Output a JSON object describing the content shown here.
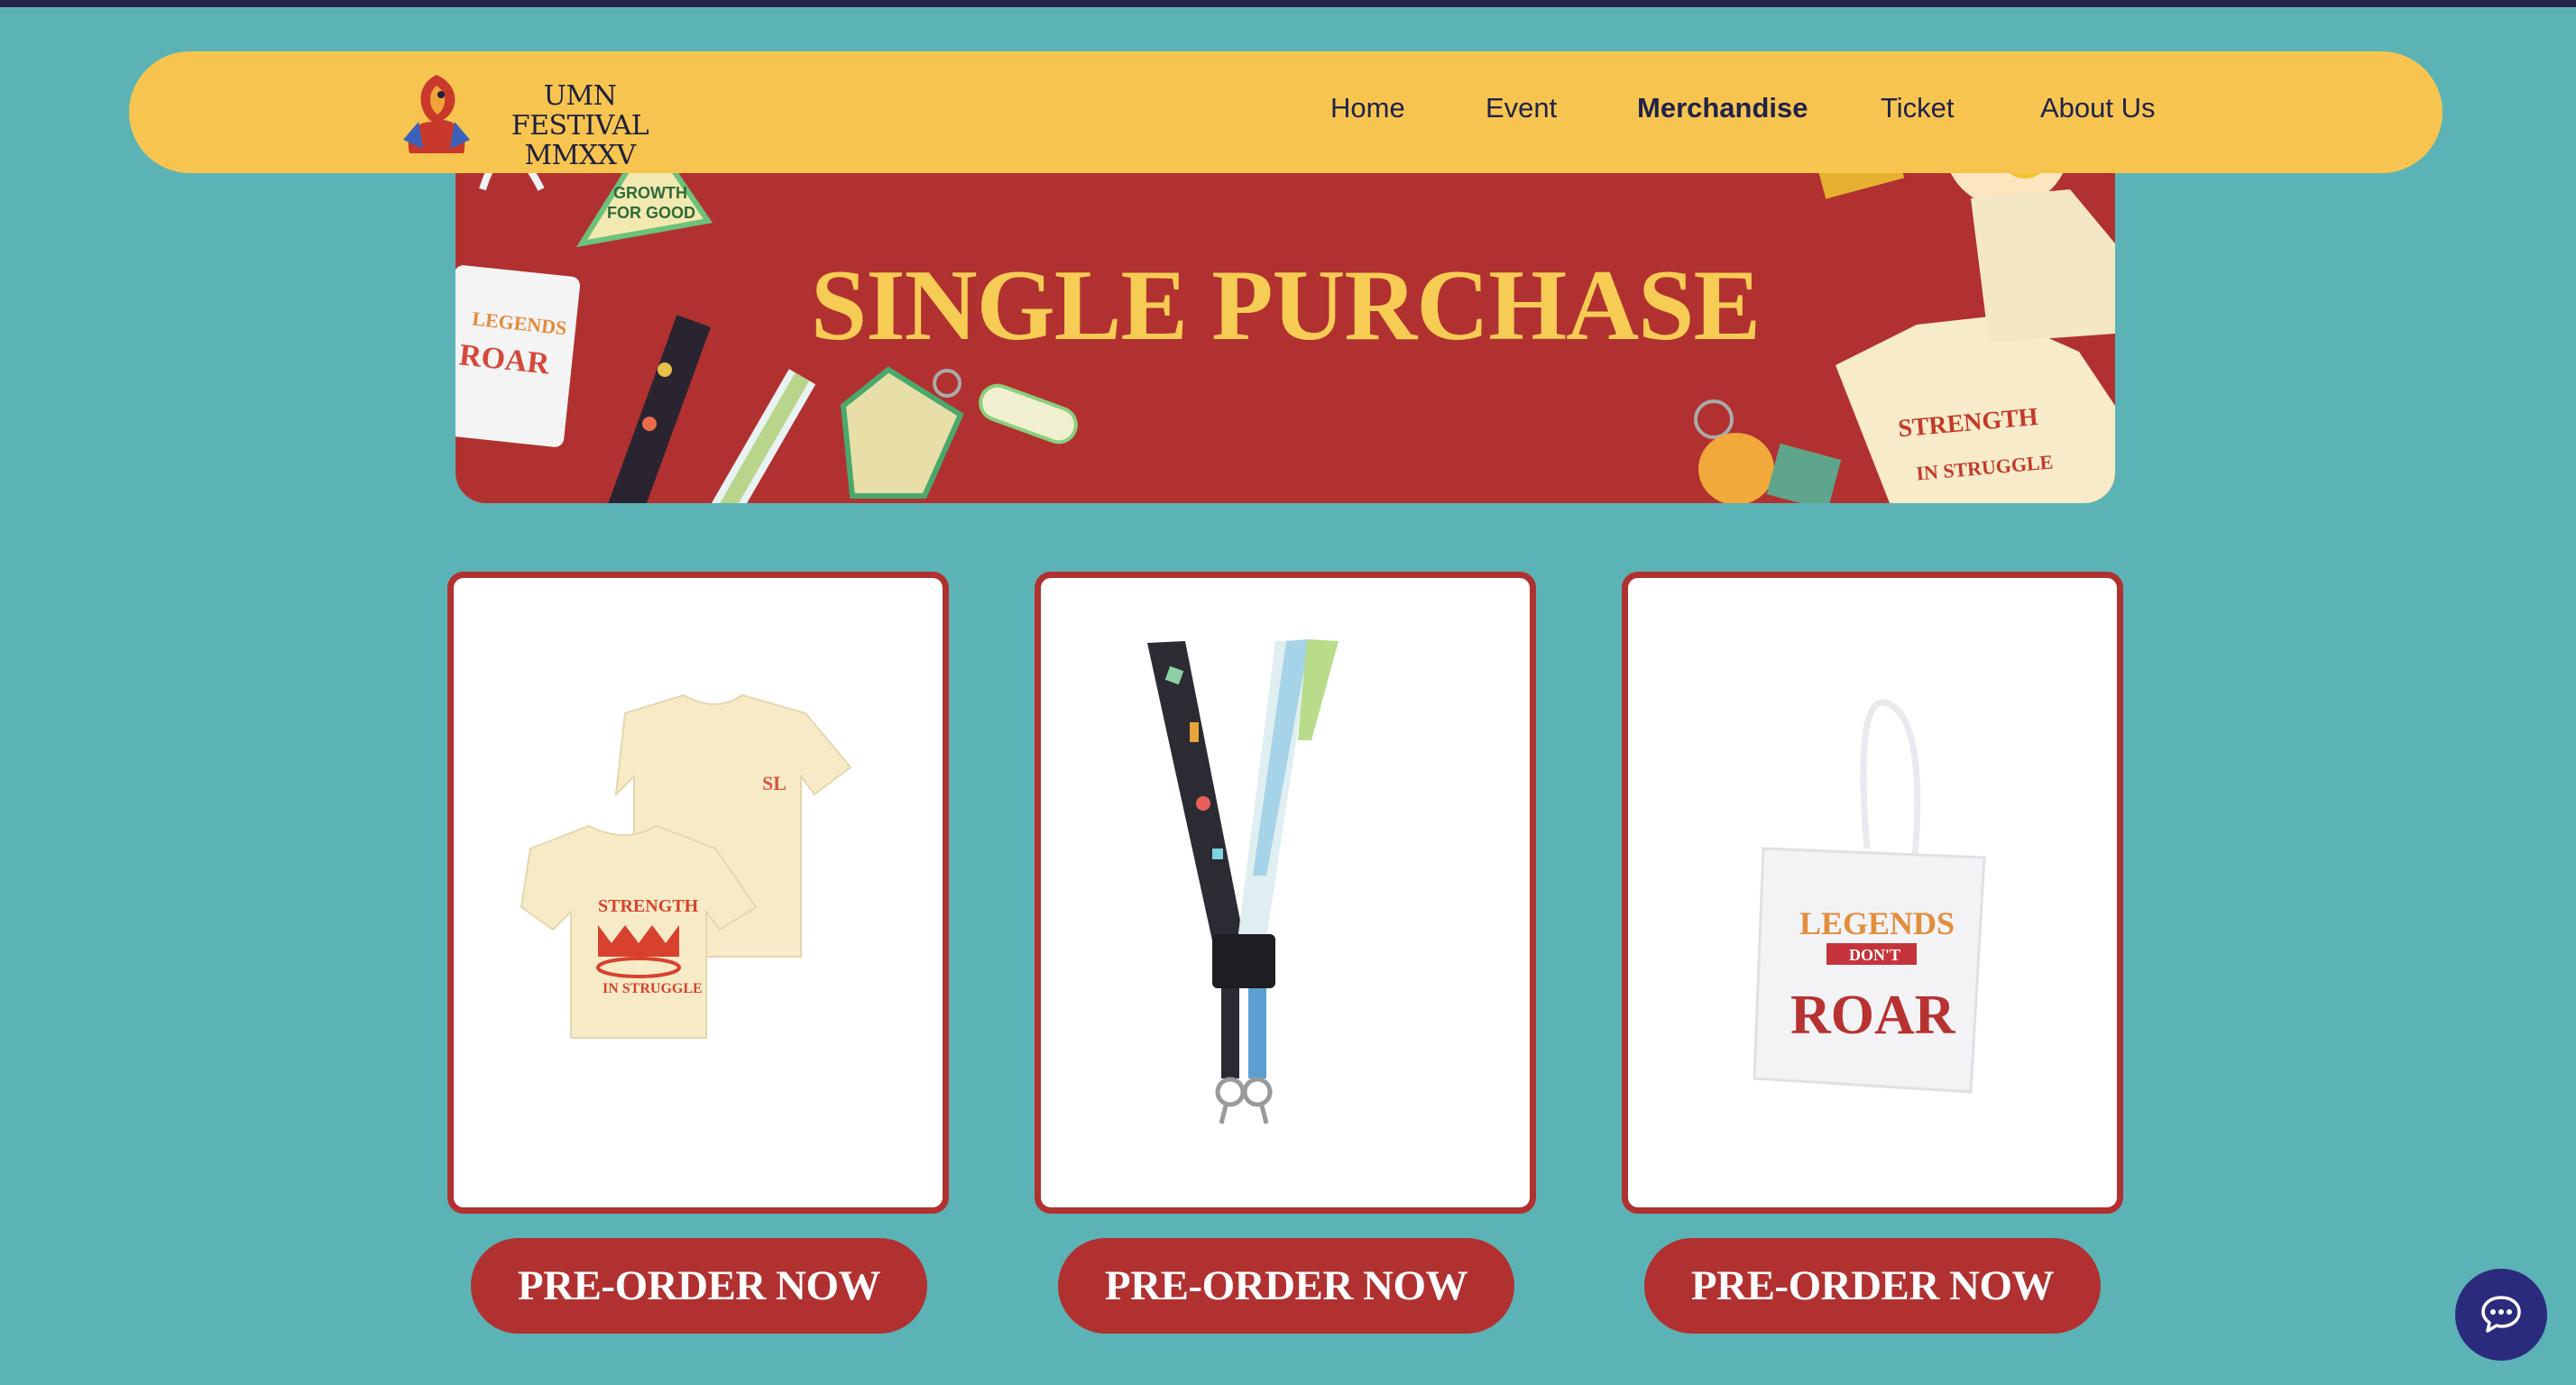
{
  "header": {
    "brand_line1": "UMN FESTIVAL",
    "brand_line2": "MMXXV",
    "nav": [
      {
        "label": "Home",
        "active": false
      },
      {
        "label": "Event",
        "active": false
      },
      {
        "label": "Merchandise",
        "active": true
      },
      {
        "label": "Ticket",
        "active": false
      },
      {
        "label": "About Us",
        "active": false
      }
    ]
  },
  "banner": {
    "title": "SINGLE PURCHASE",
    "patch_text_1": "GROWTH",
    "patch_text_2": "FOR GOOD"
  },
  "products": [
    {
      "name": "tshirt",
      "button_label": "PRE-ORDER NOW",
      "print_text_1": "STRENGTH",
      "print_text_2": "IN STRUGGLE"
    },
    {
      "name": "lanyard",
      "button_label": "PRE-ORDER NOW"
    },
    {
      "name": "tote-bag",
      "button_label": "PRE-ORDER NOW",
      "print_text_1": "LEGENDS",
      "print_text_2": "DON'T",
      "print_text_3": "ROAR"
    }
  ],
  "colors": {
    "background": "#5cb3b5",
    "header": "#f7c54f",
    "accent_red": "#b13130",
    "banner_title": "#f7cc55",
    "nav_text": "#20224a",
    "chat_button": "#2b2b7e"
  },
  "icons": {
    "logo": "dragon-logo",
    "chat": "chat-bubble-icon"
  }
}
